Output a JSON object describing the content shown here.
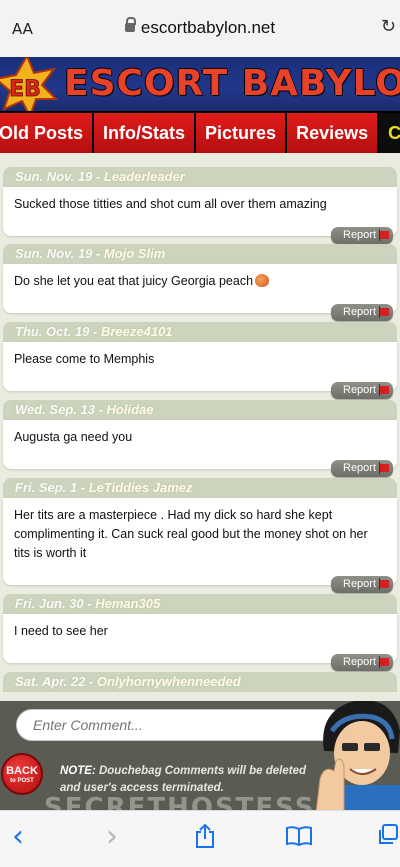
{
  "browser": {
    "text_size_label": "AA",
    "url": "escortbabylon.net",
    "reload_glyph": "↻"
  },
  "site": {
    "logo_text": "EB",
    "title": "ESCORT BABYLON",
    "nav": [
      "Old Posts",
      "Info/Stats",
      "Pictures",
      "Reviews",
      "Comments"
    ],
    "accent_red": "#e21b1b",
    "nav_active_color": "#e6e020"
  },
  "comments": [
    {
      "date": "Sun. Nov. 19",
      "user": "Leaderleader",
      "text": "Sucked those titties and shot cum all over them amazing",
      "report_label": "Report"
    },
    {
      "date": "Sun. Nov. 19",
      "user": "Mojo Slim",
      "text": "Do she let you eat that juicy Georgia peach",
      "report_label": "Report"
    },
    {
      "date": "Thu. Oct. 19",
      "user": "Breeze4101",
      "text": "Please come to Memphis",
      "report_label": "Report"
    },
    {
      "date": "Wed. Sep. 13",
      "user": "Holidae",
      "text": "Augusta ga need you",
      "report_label": "Report"
    },
    {
      "date": "Fri. Sep. 1",
      "user": "LeTiddies Jamez",
      "text": "Her tits are a masterpiece . Had my dick so hard she kept complimenting it. Can suck real good but the money shot on her tits is worth it",
      "report_label": "Report"
    },
    {
      "date": "Fri. Jun. 30",
      "user": "Heman305",
      "text": "I need to see her",
      "report_label": "Report"
    },
    {
      "date": "Sat. Apr. 22",
      "user": "Onlyhornywhenneeded",
      "text": "",
      "report_label": ""
    }
  ],
  "footer": {
    "comment_placeholder": "Enter Comment...",
    "back_label": "BACK",
    "back_sub": "to POST",
    "note_label": "NOTE:",
    "note_text": " Douchebag Comments will be deleted and user's access terminated.",
    "watermark": "SECRETHOSTESS"
  },
  "toolbar": {
    "back_glyph": "‹",
    "forward_glyph": "›"
  }
}
